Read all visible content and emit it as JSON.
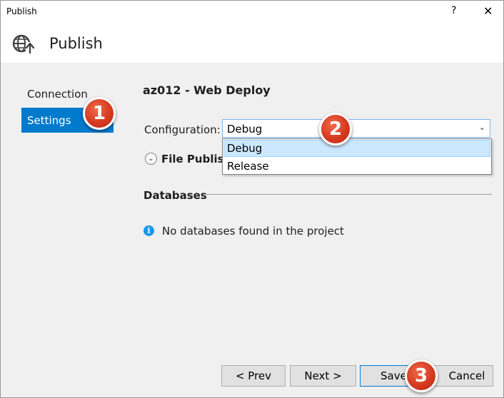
{
  "window": {
    "title": "Publish",
    "help_glyph": "?",
    "close_glyph": "✕"
  },
  "header": {
    "title": "Publish",
    "icon": "globe-publish-icon"
  },
  "nav": {
    "items": [
      {
        "label": "Connection"
      },
      {
        "label": "Settings"
      }
    ]
  },
  "badges": [
    "1",
    "2",
    "3"
  ],
  "profile": {
    "title": "az012 - Web Deploy"
  },
  "configuration": {
    "label": "Configuration:",
    "selected": "Debug",
    "options": [
      "Debug",
      "Release"
    ]
  },
  "file_publish": {
    "label": "File Publish"
  },
  "databases": {
    "heading": "Databases",
    "message": "No databases found in the project",
    "info_icon": "i"
  },
  "buttons": {
    "prev": "< Prev",
    "next": "Next >",
    "save": "Save",
    "cancel": "Cancel"
  },
  "colors": {
    "accent": "#007acc",
    "badge": "#d63a1f",
    "dropdown_highlight": "#cce8ff",
    "info": "#1c97ea"
  }
}
